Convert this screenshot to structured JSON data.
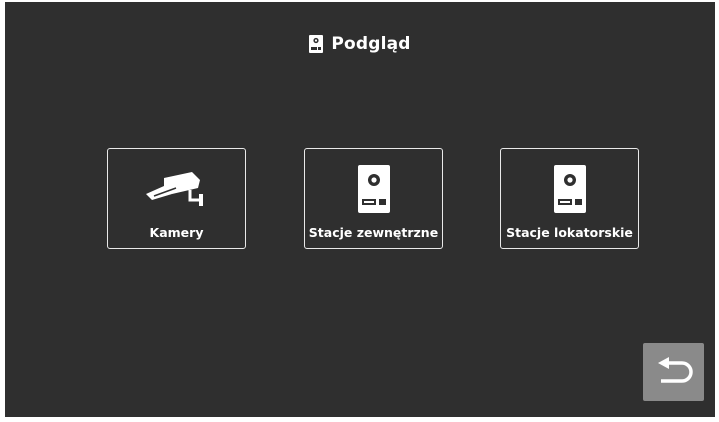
{
  "header": {
    "title": "Podgląd",
    "icon": "door-station-icon"
  },
  "tiles": [
    {
      "label": "Kamery",
      "icon": "cctv-camera-icon"
    },
    {
      "label": "Stacje zewnętrzne",
      "icon": "outdoor-station-icon"
    },
    {
      "label": "Stacje lokatorskie",
      "icon": "indoor-station-icon"
    }
  ],
  "back_button": {
    "icon": "return-arrow-icon"
  },
  "colors": {
    "background": "#2f2f2f",
    "tile_border": "#e9e9e9",
    "text": "#ffffff",
    "back_button": "#8a8a8a"
  }
}
